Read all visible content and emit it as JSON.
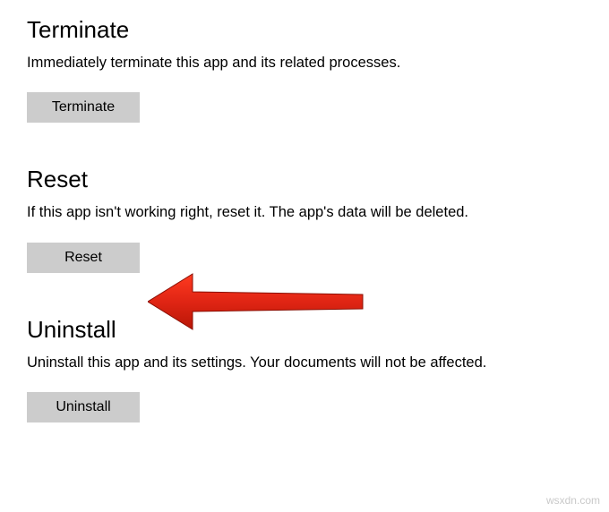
{
  "sections": {
    "terminate": {
      "title": "Terminate",
      "description": "Immediately terminate this app and its related processes.",
      "button_label": "Terminate"
    },
    "reset": {
      "title": "Reset",
      "description": "If this app isn't working right, reset it. The app's data will be deleted.",
      "button_label": "Reset"
    },
    "uninstall": {
      "title": "Uninstall",
      "description": "Uninstall this app and its settings. Your documents will not be affected.",
      "button_label": "Uninstall"
    }
  },
  "annotation": {
    "arrow_color": "#e02514"
  },
  "watermark": "wsxdn.com"
}
